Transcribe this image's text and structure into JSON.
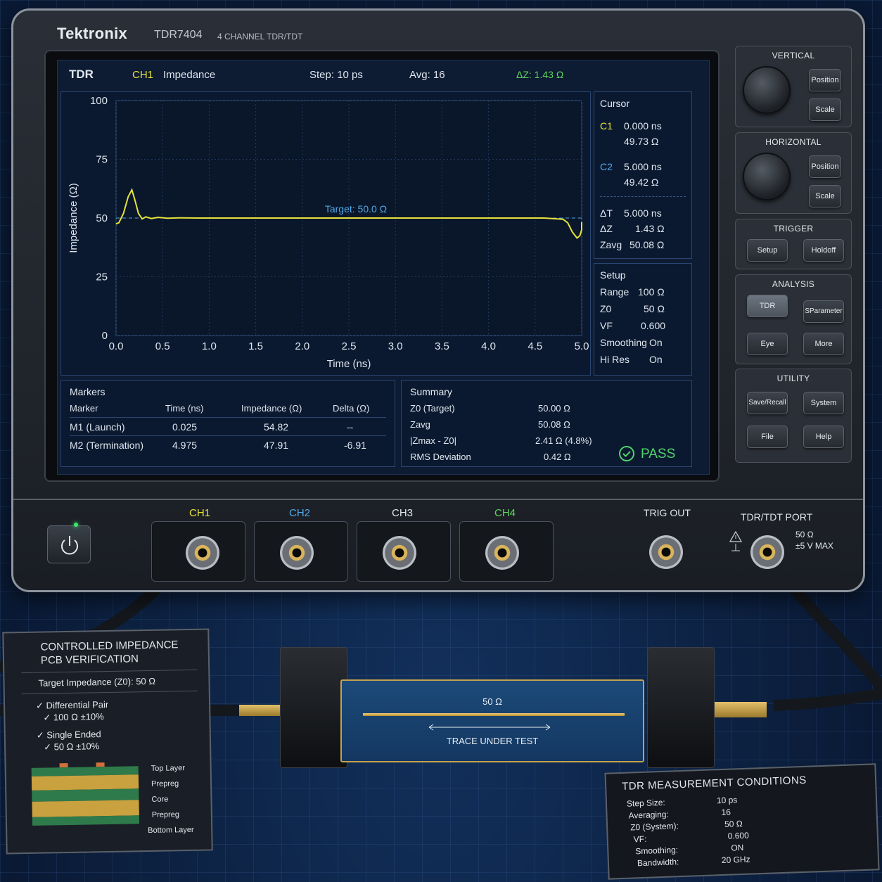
{
  "instrument": {
    "brand": "Tektronix",
    "model": "TDR7404",
    "model_desc": "4 CHANNEL TDR/TDT"
  },
  "topbar": {
    "mode": "TDR",
    "channel": "CH1",
    "measure": "Impedance",
    "step": "Step: 10 ps",
    "avg": "Avg: 16",
    "delta": "ΔZ: 1.43 Ω"
  },
  "chart_data": {
    "type": "line",
    "ylabel": "Impedance (Ω)",
    "xlabel": "Time (ns)",
    "xlim": [
      0,
      5.0
    ],
    "ylim": [
      0,
      100
    ],
    "x_ticks": [
      "0.0",
      "0.5",
      "1.0",
      "1.5",
      "2.0",
      "2.5",
      "3.0",
      "3.5",
      "4.0",
      "4.5",
      "5.0"
    ],
    "y_ticks": [
      "0",
      "25",
      "50",
      "75",
      "100"
    ],
    "grid": true,
    "reference_line": {
      "label": "Target: 50.0 Ω",
      "value": 50
    },
    "series": [
      {
        "color": "#e6e23a",
        "x": [
          0.0,
          0.03,
          0.08,
          0.13,
          0.17,
          0.2,
          0.24,
          0.28,
          0.32,
          0.38,
          0.45,
          0.55,
          0.7,
          0.9,
          1.2,
          2.0,
          3.0,
          4.0,
          4.6,
          4.8,
          4.85,
          4.9,
          4.95,
          4.98,
          5.0,
          5.03,
          5.08,
          5.12
        ],
        "y": [
          47.5,
          48,
          52,
          59,
          62,
          58,
          52,
          49.6,
          50.5,
          49.8,
          50.3,
          49.9,
          50.1,
          50,
          50,
          50,
          50,
          50,
          50,
          49.5,
          48,
          44,
          41.5,
          42.5,
          45,
          47,
          48,
          48.3
        ]
      }
    ]
  },
  "cursor": {
    "title": "Cursor",
    "c1_label": "C1",
    "c1_time": "0.000 ns",
    "c1_val": "49.73 Ω",
    "c2_label": "C2",
    "c2_time": "5.000 ns",
    "c2_val": "49.42 Ω",
    "dt_label": "ΔT",
    "dt_val": "5.000 ns",
    "dz_label": "ΔZ",
    "dz_val": "1.43 Ω",
    "zavg_label": "Zavg",
    "zavg_val": "50.08 Ω"
  },
  "setup": {
    "title": "Setup",
    "rows": [
      {
        "k": "Range",
        "v": "100 Ω"
      },
      {
        "k": "Z0",
        "v": "50 Ω"
      },
      {
        "k": "VF",
        "v": "0.600"
      },
      {
        "k": "Smoothing",
        "v": "On"
      },
      {
        "k": "Hi Res",
        "v": "On"
      }
    ]
  },
  "markers": {
    "title": "Markers",
    "headers": [
      "Marker",
      "Time (ns)",
      "Impedance (Ω)",
      "Delta (Ω)"
    ],
    "rows": [
      [
        "M1 (Launch)",
        "0.025",
        "54.82",
        "--"
      ],
      [
        "M2 (Termination)",
        "4.975",
        "47.91",
        "-6.91"
      ]
    ]
  },
  "summary": {
    "title": "Summary",
    "rows": [
      {
        "k": "Z0 (Target)",
        "v": "50.00 Ω"
      },
      {
        "k": "Zavg",
        "v": "50.08 Ω"
      },
      {
        "k": "|Zmax - Z0|",
        "v": "2.41 Ω (4.8%)"
      },
      {
        "k": "RMS Deviation",
        "v": "0.42 Ω"
      }
    ],
    "status": "PASS"
  },
  "controls": {
    "vertical": {
      "title": "VERTICAL",
      "b1": "Position",
      "b2": "Scale"
    },
    "horizontal": {
      "title": "HORIZONTAL",
      "b1": "Position",
      "b2": "Scale"
    },
    "trigger": {
      "title": "TRIGGER",
      "b1": "Setup",
      "b2": "Holdoff"
    },
    "analysis": {
      "title": "ANALYSIS",
      "b1": "TDR",
      "b2": "SParameter",
      "b3": "Eye",
      "b4": "More"
    },
    "utility": {
      "title": "UTILITY",
      "b1": "Save/Recall",
      "b2": "System",
      "b3": "File",
      "b4": "Help"
    }
  },
  "front": {
    "ch1": "CH1",
    "ch2": "CH2",
    "ch3": "CH3",
    "ch4": "CH4",
    "trig_out": "TRIG OUT",
    "tdr_port": "TDR/TDT PORT",
    "port_spec1": "50 Ω",
    "port_spec2": "±5 V MAX"
  },
  "colors": {
    "ch1": "#e6e23a",
    "ch2": "#4fa8e8",
    "ch4": "#5ed35e",
    "pass": "#4fd36b"
  },
  "verify_card": {
    "title1": "CONTROLLED IMPEDANCE",
    "title2": "PCB VERIFICATION",
    "target": "Target Impedance (Z0):  50 Ω",
    "diff1": "✓ Differential Pair",
    "diff2": "✓ 100 Ω ±10%",
    "se1": "✓ Single Ended",
    "se2": "✓ 50 Ω ±10%",
    "layers": [
      "Top Layer",
      "Prepreg",
      "Core",
      "Prepreg",
      "Bottom Layer"
    ]
  },
  "board": {
    "impedance": "50 Ω",
    "label": "TRACE UNDER TEST"
  },
  "conditions_card": {
    "title": "TDR MEASUREMENT CONDITIONS",
    "rows": [
      {
        "k": "Step Size:",
        "v": "10 ps"
      },
      {
        "k": "Averaging:",
        "v": "16"
      },
      {
        "k": "Z0 (System):",
        "v": "50 Ω"
      },
      {
        "k": "VF:",
        "v": "0.600"
      },
      {
        "k": "Smoothing:",
        "v": "ON"
      },
      {
        "k": "Bandwidth:",
        "v": "20 GHz"
      }
    ]
  }
}
